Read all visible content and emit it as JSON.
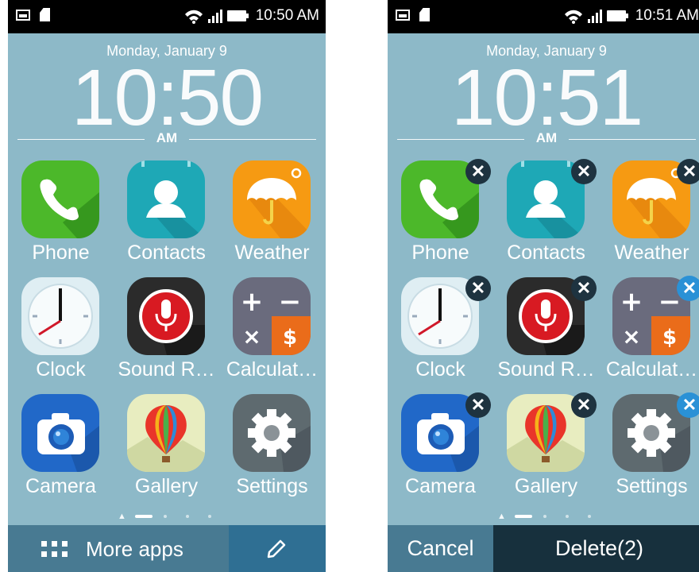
{
  "left_screen": {
    "status_bar": {
      "time": "10:50 AM"
    },
    "date": "Monday, January 9",
    "clock": "10:50",
    "ampm": "AM",
    "apps": [
      {
        "label": "Phone"
      },
      {
        "label": "Contacts"
      },
      {
        "label": "Weather"
      },
      {
        "label": "Clock"
      },
      {
        "label": "Sound R…"
      },
      {
        "label": "Calculat…"
      },
      {
        "label": "Camera"
      },
      {
        "label": "Gallery"
      },
      {
        "label": "Settings"
      }
    ],
    "bottom_bar": {
      "more_apps_label": "More apps",
      "edit_icon": "pencil-icon"
    }
  },
  "right_screen": {
    "status_bar": {
      "time": "10:51 AM"
    },
    "date": "Monday, January 9",
    "clock": "10:51",
    "ampm": "AM",
    "apps": [
      {
        "label": "Phone",
        "selected": false
      },
      {
        "label": "Contacts",
        "selected": false
      },
      {
        "label": "Weather",
        "selected": false
      },
      {
        "label": "Clock",
        "selected": false
      },
      {
        "label": "Sound R…",
        "selected": false
      },
      {
        "label": "Calculat…",
        "selected": true
      },
      {
        "label": "Camera",
        "selected": false
      },
      {
        "label": "Gallery",
        "selected": false
      },
      {
        "label": "Settings",
        "selected": true
      }
    ],
    "delete_badge_glyph": "✕",
    "bottom_bar": {
      "cancel_label": "Cancel",
      "delete_label": "Delete(2)"
    }
  },
  "colors": {
    "wallpaper": "#8db9c8",
    "bottom_bar": "#487a92",
    "delete_bar": "#17303d",
    "badge_default": "#1e3340",
    "badge_selected": "#2a91d6"
  }
}
